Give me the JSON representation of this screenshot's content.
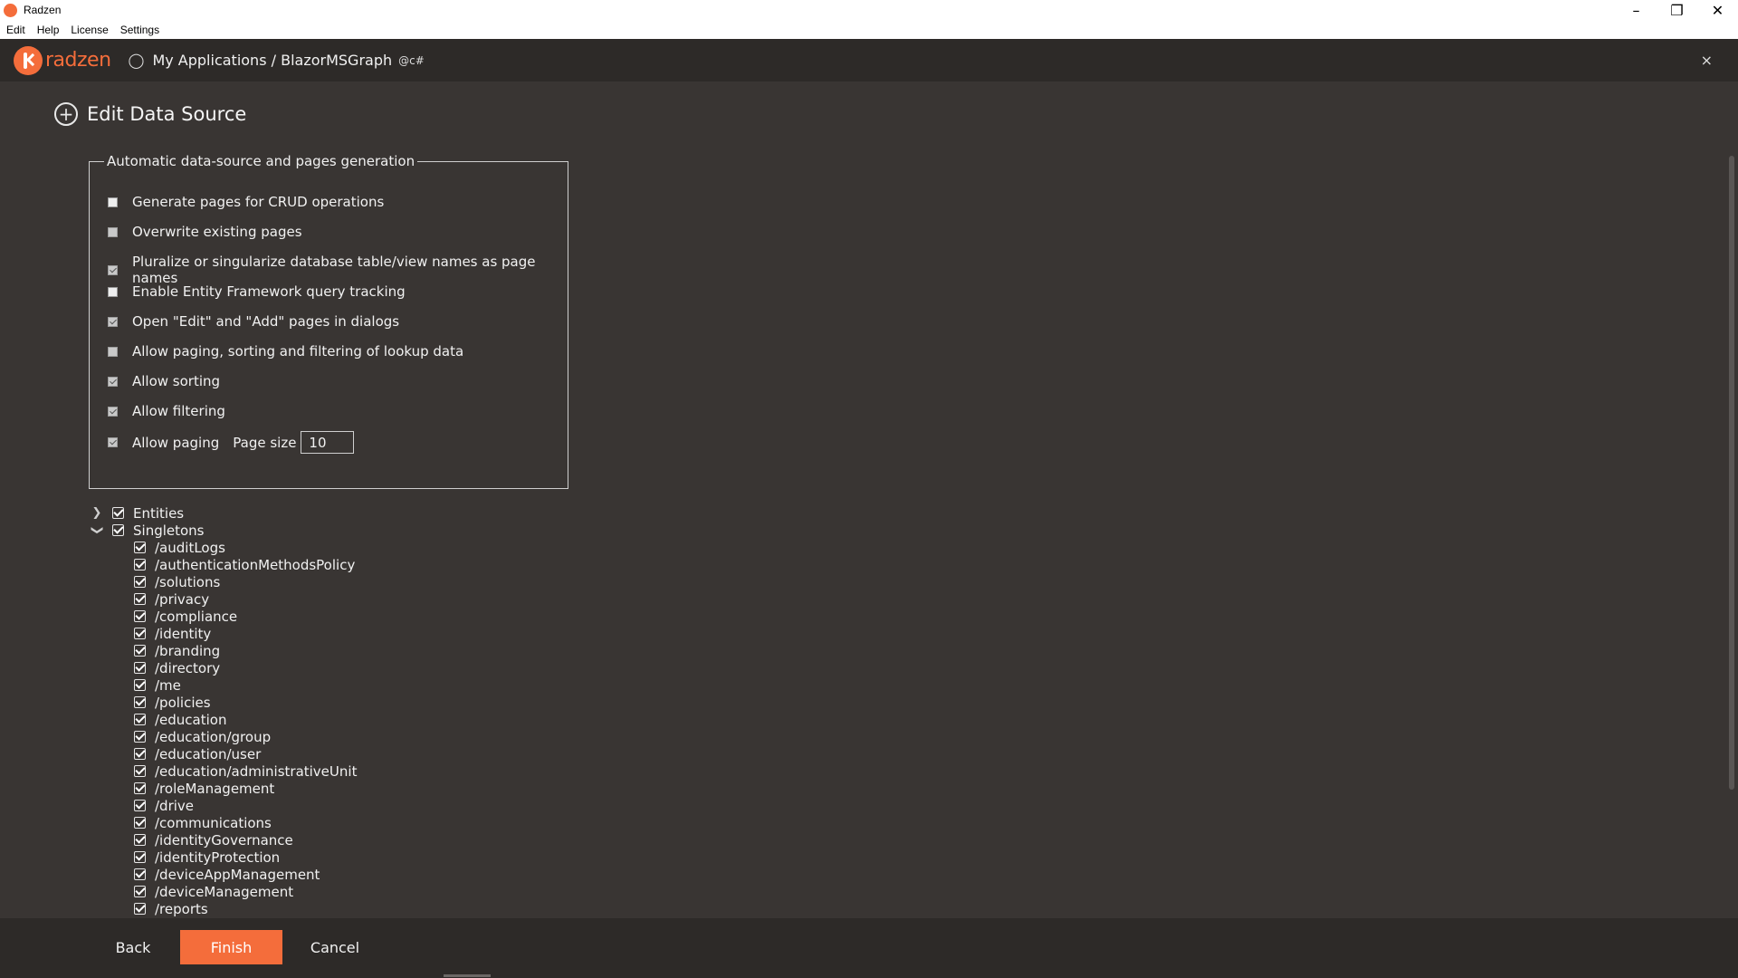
{
  "window": {
    "title": "Radzen",
    "minimize": "–",
    "maximize": "❐",
    "close": "✕"
  },
  "menu": [
    "Edit",
    "Help",
    "License",
    "Settings"
  ],
  "header": {
    "brand": "radzen",
    "breadcrumb": "My Applications / BlazorMSGraph",
    "lang_badge": "@c#",
    "close": "×"
  },
  "page": {
    "title": "Edit Data Source"
  },
  "generation": {
    "legend": "Automatic data-source and pages generation",
    "options": [
      {
        "label": "Generate pages for CRUD operations",
        "checked": false
      },
      {
        "label": "Overwrite existing pages",
        "checked": false
      },
      {
        "label": "Pluralize or singularize database table/view names as page names",
        "checked": true
      },
      {
        "label": "Enable Entity Framework query tracking",
        "checked": false
      },
      {
        "label": "Open \"Edit\" and \"Add\" pages in dialogs",
        "checked": true
      },
      {
        "label": "Allow paging, sorting and filtering of lookup data",
        "checked": false
      },
      {
        "label": "Allow sorting",
        "checked": true
      },
      {
        "label": "Allow filtering",
        "checked": true
      },
      {
        "label": "Allow paging",
        "checked": true
      }
    ],
    "page_size_label": "Page size",
    "page_size": "10"
  },
  "tree": {
    "entities": {
      "label": "Entities",
      "expanded": false
    },
    "singletons": {
      "label": "Singletons",
      "expanded": true,
      "items": [
        "/auditLogs",
        "/authenticationMethodsPolicy",
        "/solutions",
        "/privacy",
        "/compliance",
        "/identity",
        "/branding",
        "/directory",
        "/me",
        "/policies",
        "/education",
        "/education/group",
        "/education/user",
        "/education/administrativeUnit",
        "/roleManagement",
        "/drive",
        "/communications",
        "/identityGovernance",
        "/identityProtection",
        "/deviceAppManagement",
        "/deviceManagement",
        "/reports"
      ]
    }
  },
  "footer": {
    "back": "Back",
    "finish": "Finish",
    "cancel": "Cancel"
  },
  "colors": {
    "accent": "#f46d3b",
    "background": "#393533",
    "header": "#2d2a28"
  }
}
